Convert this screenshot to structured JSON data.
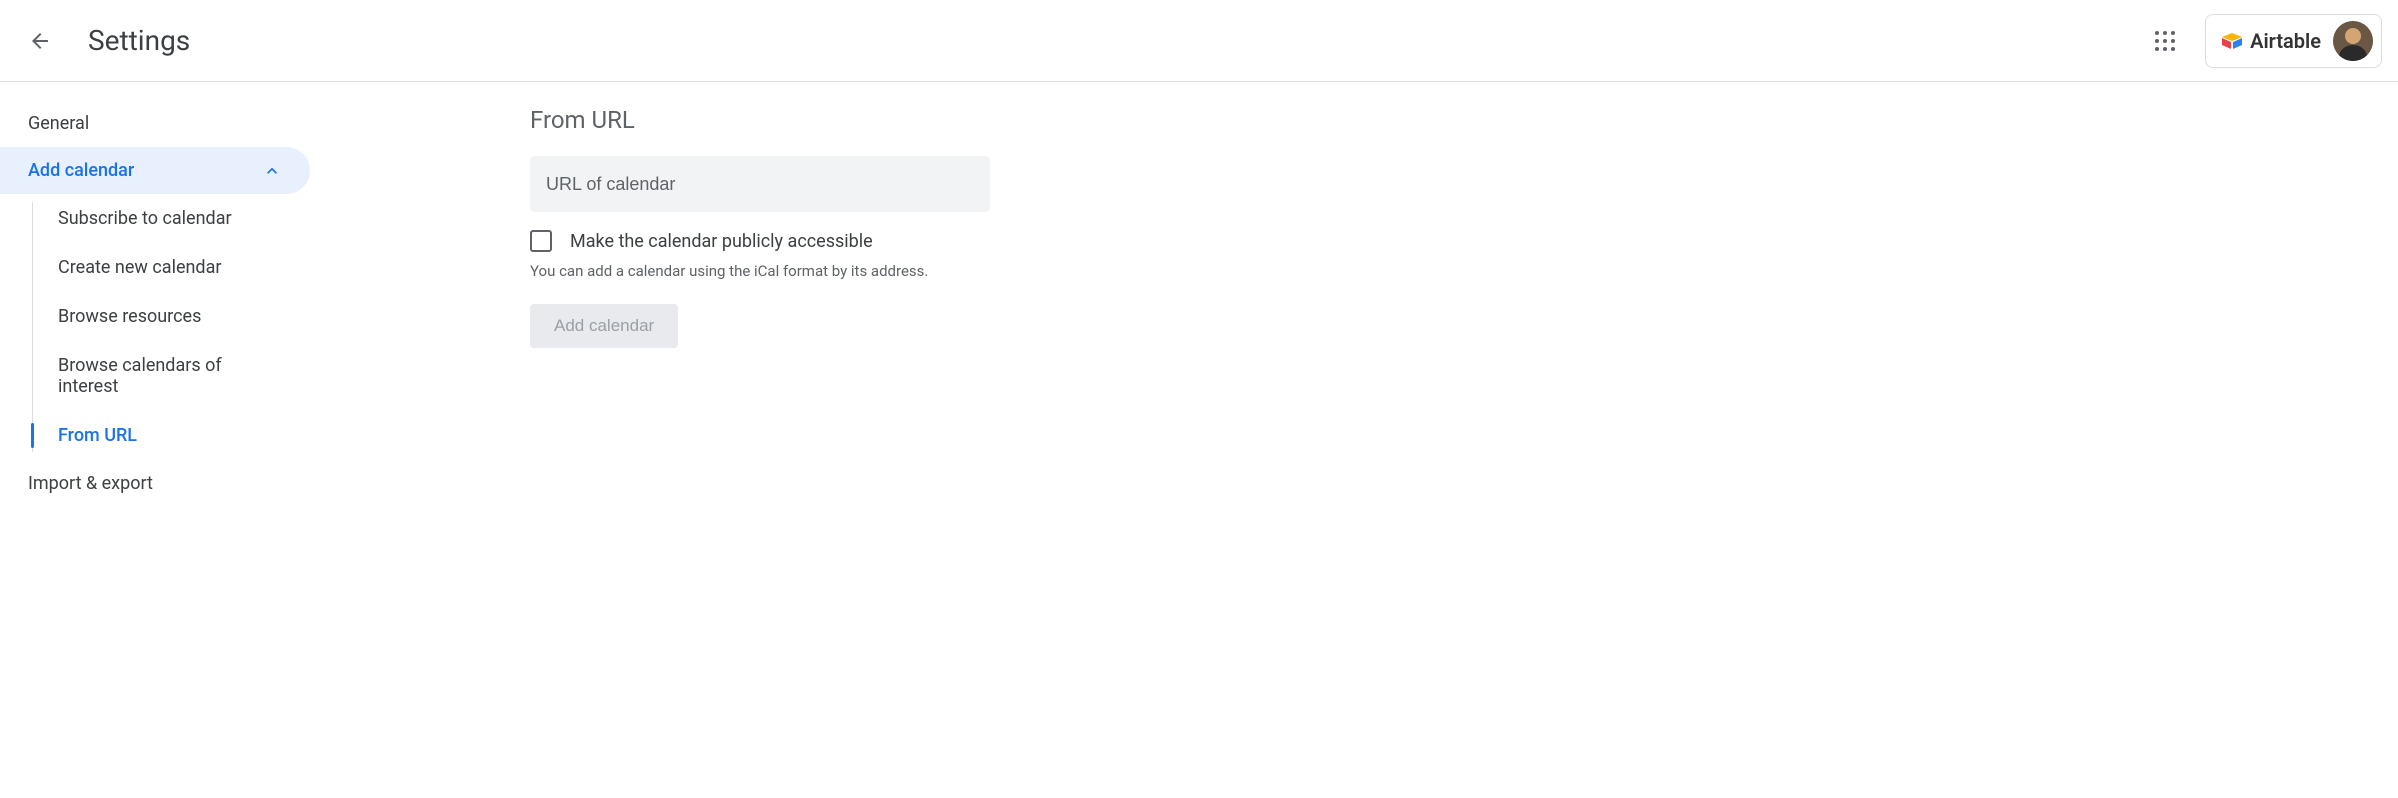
{
  "header": {
    "title": "Settings",
    "account_label": "Airtable"
  },
  "sidebar": {
    "items": [
      {
        "label": "General"
      },
      {
        "label": "Add calendar",
        "expanded": true
      },
      {
        "label": "Import & export"
      }
    ],
    "sub_items": [
      {
        "label": "Subscribe to calendar"
      },
      {
        "label": "Create new calendar"
      },
      {
        "label": "Browse resources"
      },
      {
        "label": "Browse calendars of interest"
      },
      {
        "label": "From URL",
        "selected": true
      }
    ]
  },
  "main": {
    "section_title": "From URL",
    "url_placeholder": "URL of calendar",
    "checkbox_label": "Make the calendar publicly accessible",
    "help_text": "You can add a calendar using the iCal format by its address.",
    "add_button_label": "Add calendar"
  }
}
